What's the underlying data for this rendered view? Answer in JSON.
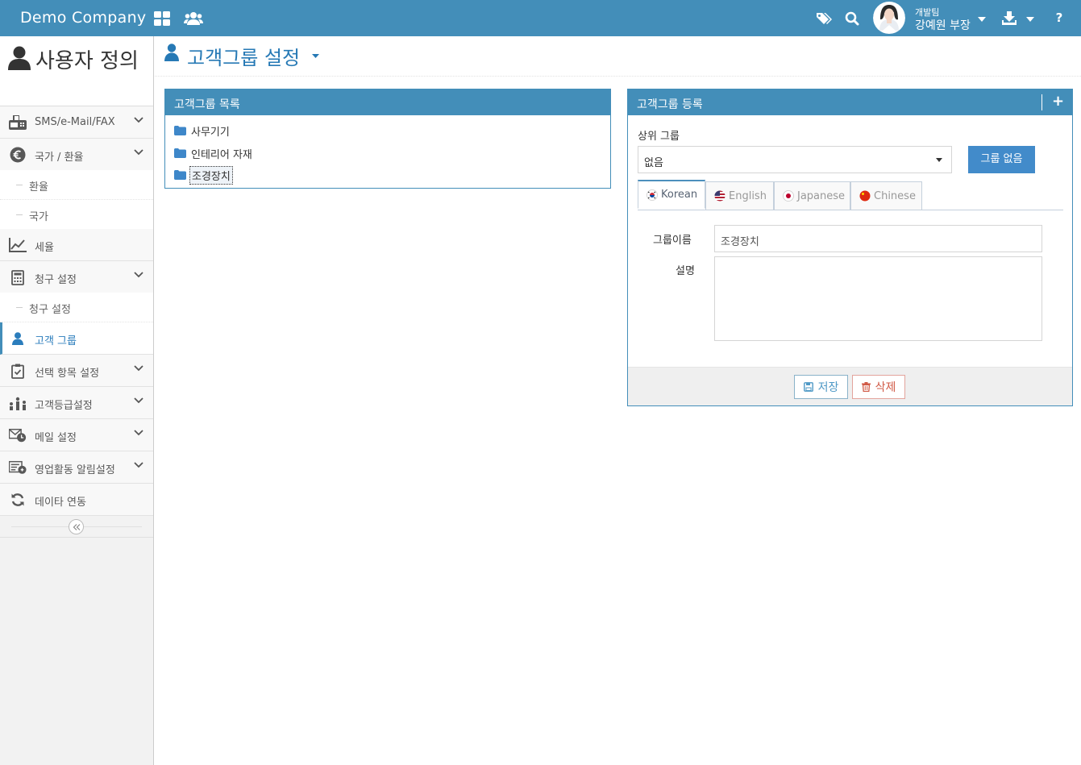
{
  "brand": "Demo Company",
  "colors": {
    "topbar": "#438eb9",
    "accent": "#2679b5",
    "panel": "#438eb9"
  },
  "user": {
    "team": "개발팀",
    "name": "강예원 부장"
  },
  "topbar_icons": [
    "grid-icon",
    "users-icon",
    "tags-icon",
    "search-icon",
    "caret-down-icon",
    "download-icon",
    "caret-down-icon",
    "help-icon"
  ],
  "help_label": "?",
  "sidebar": {
    "title": "사용자 정의",
    "items": [
      {
        "label": "SMS/e-Mail/FAX",
        "icon": "fax-icon"
      },
      {
        "label": "국가 / 환율",
        "icon": "euro-icon"
      },
      {
        "label": "환율"
      },
      {
        "label": "국가"
      },
      {
        "label": "세율",
        "icon": "line-chart-icon"
      },
      {
        "label": "청구 설정",
        "icon": "calculator-icon"
      },
      {
        "label": "청구 설정"
      },
      {
        "label": "고객 그룹",
        "icon": "user-icon"
      },
      {
        "label": "선택 항목 설정",
        "icon": "check-clipboard-icon"
      },
      {
        "label": "고객등급설정",
        "icon": "rank-icon"
      },
      {
        "label": "메일 설정",
        "icon": "mail-clock-icon"
      },
      {
        "label": "영업활동 알림설정",
        "icon": "alarm-list-icon"
      },
      {
        "label": "데이타 연동",
        "icon": "refresh-icon"
      }
    ],
    "collapse_icon": "double-chevron-left-icon"
  },
  "page": {
    "title": "고객그룹 설정"
  },
  "list_panel": {
    "title": "고객그룹 목록",
    "items": [
      "사무기기",
      "인테리어 자재",
      "조경장치"
    ],
    "selected": "조경장치"
  },
  "form_panel": {
    "title": "고객그룹 등록",
    "add_label": "+",
    "parent_label": "상위 그룹",
    "parent_value": "없음",
    "no_group_button": "그룹 없음",
    "tabs": [
      "Korean",
      "English",
      "Japanese",
      "Chinese"
    ],
    "active_tab": "Korean",
    "name_label": "그룹이름",
    "name_value": "조경장치",
    "desc_label": "설명",
    "desc_value": "",
    "save_label": "저장",
    "delete_label": "삭제"
  }
}
